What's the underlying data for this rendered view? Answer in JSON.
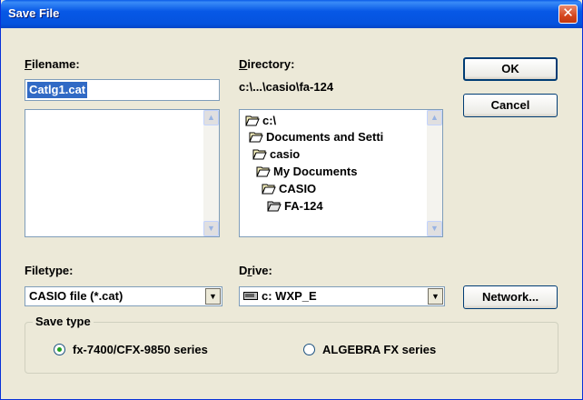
{
  "window": {
    "title": "Save File",
    "close_glyph": "✕"
  },
  "filename": {
    "label_accel": "F",
    "label_rest": "ilename:",
    "value": "Catlg1.cat"
  },
  "directory": {
    "label_accel": "D",
    "label_rest": "irectory:",
    "path": "c:\\...\\casio\\fa-124",
    "items": [
      {
        "label": "c:\\",
        "icon": "open-folder-icon"
      },
      {
        "label": "Documents and Setti",
        "icon": "open-folder-icon"
      },
      {
        "label": "casio",
        "icon": "open-folder-icon"
      },
      {
        "label": "My Documents",
        "icon": "open-folder-icon"
      },
      {
        "label": "CASIO",
        "icon": "open-folder-icon"
      },
      {
        "label": "FA-124",
        "icon": "open-folder-icon"
      }
    ]
  },
  "buttons": {
    "ok": "OK",
    "cancel": "Cancel",
    "network": "Network..."
  },
  "filetype": {
    "label_accel": "",
    "label": "Filetype:",
    "value": "CASIO file (*.cat)"
  },
  "drive": {
    "label_pre": "D",
    "label_accel": "r",
    "label_rest": "ive:",
    "value": "c: WXP_E",
    "icon": "hard-drive-icon"
  },
  "save_type": {
    "legend": "Save type",
    "options": [
      {
        "label": "fx-7400/CFX-9850 series",
        "selected": true
      },
      {
        "label": "ALGEBRA FX series",
        "selected": false
      }
    ]
  },
  "icons": {
    "scroll_up": "▲",
    "scroll_down": "▼",
    "dropdown": "▼"
  },
  "colors": {
    "titlebar": "#0758e6",
    "selection": "#316ac5",
    "dialog_bg": "#ece9d8"
  }
}
